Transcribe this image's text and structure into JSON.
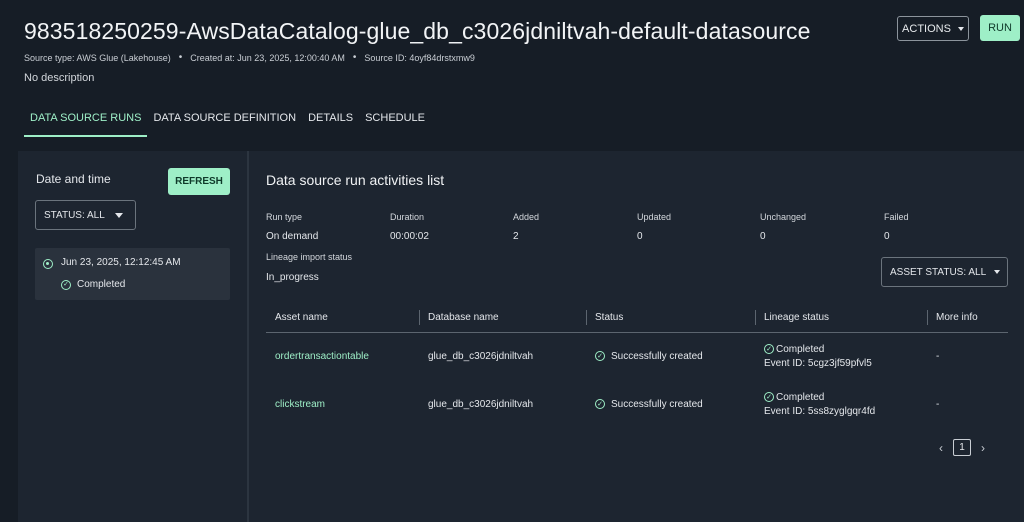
{
  "header": {
    "title": "983518250259-AwsDataCatalog-glue_db_c3026jdniltvah-default-datasource",
    "source_type": "Source type: AWS Glue (Lakehouse)",
    "created_at": "Created at: Jun 23, 2025, 12:00:40 AM",
    "source_id": "Source ID: 4oyf84drstxmw9",
    "separator": "•",
    "description": "No description",
    "actions_label": "ACTIONS",
    "run_label": "RUN"
  },
  "tabs": [
    {
      "label": "DATA SOURCE RUNS",
      "active": true
    },
    {
      "label": "DATA SOURCE DEFINITION",
      "active": false
    },
    {
      "label": "DETAILS",
      "active": false
    },
    {
      "label": "SCHEDULE",
      "active": false
    }
  ],
  "left_panel": {
    "title": "Date and time",
    "refresh_label": "REFRESH",
    "status_filter": "STATUS: ALL",
    "runs": [
      {
        "date": "Jun 23, 2025, 12:12:45 AM",
        "status": "Completed",
        "selected": true
      }
    ]
  },
  "right_panel": {
    "title": "Data source run activities list",
    "stats": {
      "run_type_label": "Run type",
      "run_type": "On demand",
      "duration_label": "Duration",
      "duration": "00:00:02",
      "added_label": "Added",
      "added": "2",
      "updated_label": "Updated",
      "updated": "0",
      "unchanged_label": "Unchanged",
      "unchanged": "0",
      "failed_label": "Failed",
      "failed": "0",
      "lineage_label": "Lineage import status",
      "lineage": "In_progress"
    },
    "asset_status_filter": "ASSET STATUS: ALL",
    "table": {
      "columns": [
        "Asset name",
        "Database name",
        "Status",
        "Lineage status",
        "More info"
      ],
      "rows": [
        {
          "asset": "ordertransactiontable",
          "database": "glue_db_c3026jdniltvah",
          "status": "Successfully created",
          "lineage": "Completed",
          "event": "Event ID: 5cgz3jf59pfvl5",
          "more": "-"
        },
        {
          "asset": "clickstream",
          "database": "glue_db_c3026jdniltvah",
          "status": "Successfully created",
          "lineage": "Completed",
          "event": "Event ID: 5ss8zyglgqr4fd",
          "more": "-"
        }
      ]
    },
    "pagination": {
      "prev": "‹",
      "page": "1",
      "next": "›"
    }
  },
  "icons": {
    "check": "check-circle-icon",
    "caret": "caret-down-icon",
    "radio": "radio-selected-icon"
  },
  "colors": {
    "accent": "#9eefc7",
    "background": "#161d26",
    "panel": "#1d2530"
  }
}
